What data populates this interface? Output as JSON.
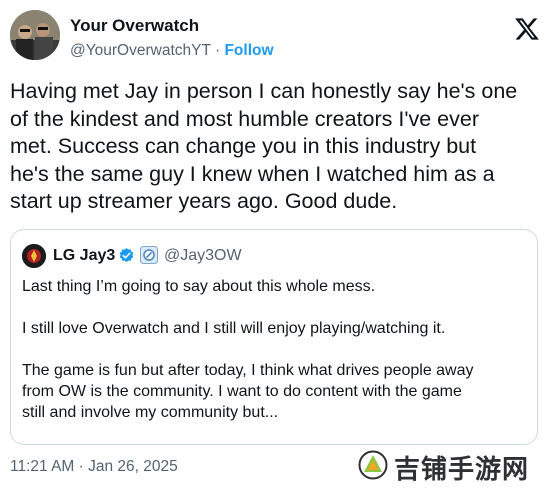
{
  "author": {
    "name": "Your Overwatch",
    "handle": "@YourOverwatchYT",
    "separator": "·",
    "follow_label": "Follow"
  },
  "tweet": {
    "lines": [
      "Having met Jay in person I can honestly say he's one",
      "of the kindest and most humble creators I've ever",
      "met. Success can change you in this industry but",
      "he's the same guy I knew when I watched him as a",
      "start up streamer years ago. Good dude."
    ]
  },
  "quote": {
    "name": "LG Jay3",
    "handle": "@Jay3OW",
    "paragraphs": [
      [
        "Last thing I’m going to say about this whole mess."
      ],
      [
        "I still love Overwatch and I still will enjoy playing/watching it."
      ],
      [
        "The game is fun but after today, I think what drives people away",
        "from OW is the community. I want to do content with the game",
        "still and involve my community but..."
      ]
    ]
  },
  "timestamp": "11:21 AM · Jan 26, 2025",
  "watermark": {
    "text": "吉铺手游网"
  },
  "colors": {
    "link": "#1d9bf0",
    "muted": "#536471",
    "text": "#0f1419",
    "border": "#cfd9de"
  },
  "icons": {
    "platform": "x-logo-icon",
    "verified": "verified-check-icon",
    "affiliate": "affiliate-badge-icon"
  }
}
